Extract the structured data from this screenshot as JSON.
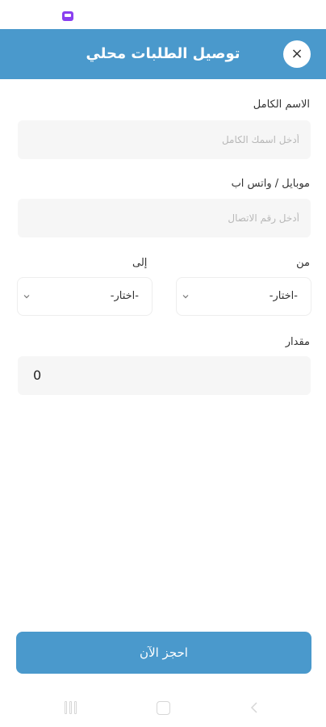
{
  "header": {
    "title": "توصيل الطلبات محلي",
    "close_label": "×"
  },
  "form": {
    "name": {
      "label": "الاسم الكامل",
      "placeholder": "أدخل اسمك الكامل",
      "value": ""
    },
    "phone": {
      "label": "موبايل / واتس اب",
      "placeholder": "أدخل رقم الاتصال",
      "value": ""
    },
    "from": {
      "label": "من",
      "selected": "-اختار-"
    },
    "to": {
      "label": "إلى",
      "selected": "-اختار-"
    },
    "quantity": {
      "label": "مقدار",
      "value": "0"
    }
  },
  "actions": {
    "book_label": "احجز الآن"
  },
  "colors": {
    "primary": "#4a99cc",
    "input_bg": "#f6f6f6",
    "notification": "#8a3ff0"
  },
  "icons": {
    "close": "close-icon",
    "chevron": "chevron-down-icon",
    "status": "notification-icon",
    "nav": [
      "recent-apps-icon",
      "home-icon",
      "back-icon"
    ]
  }
}
